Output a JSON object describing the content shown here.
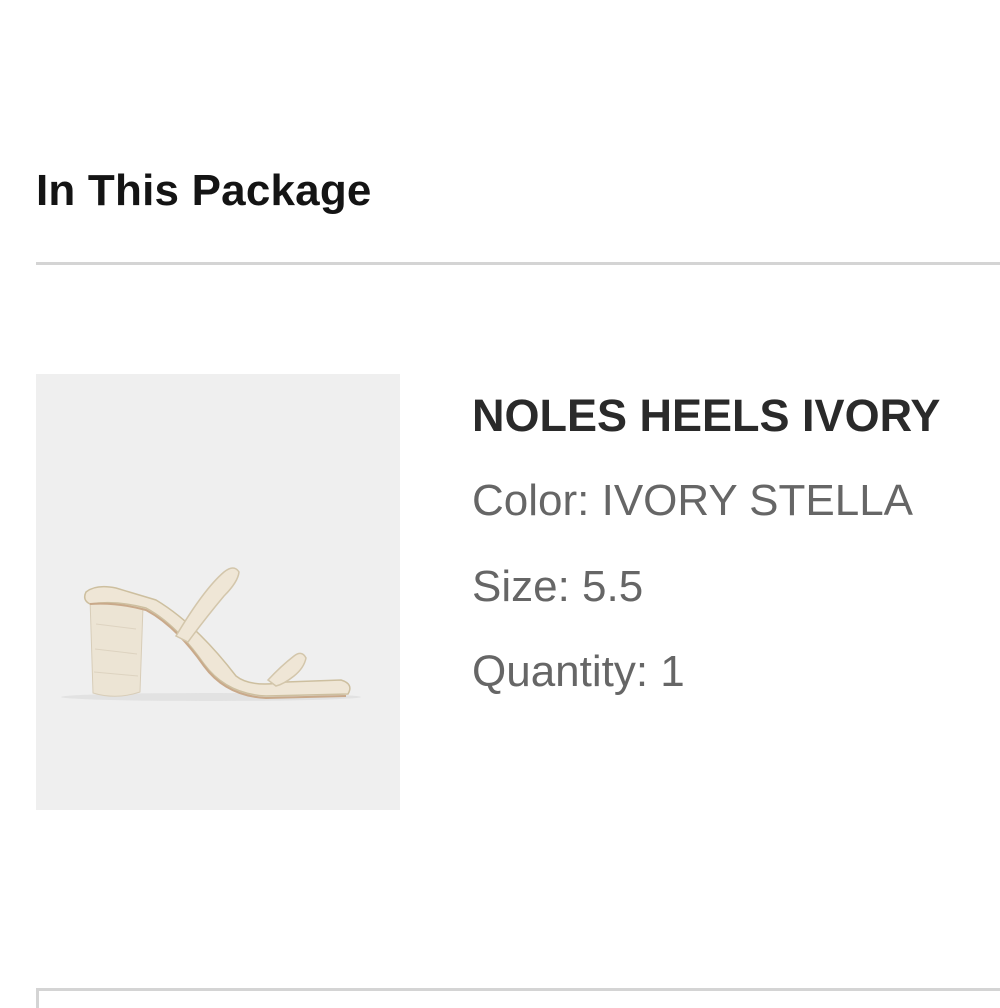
{
  "package": {
    "title": "In This Package"
  },
  "item": {
    "image_alt": "NOLES HEELS IVORY",
    "name": "NOLES HEELS IVORY",
    "color_line": "Color: IVORY STELLA",
    "size_line": "Size: 5.5",
    "quantity_line": "Quantity: 1"
  },
  "colors": {
    "title_text": "#141414",
    "name_text": "#2a2a2a",
    "detail_text": "#666666",
    "divider": "#d4d4d4",
    "image_bg": "#efefef",
    "shoe_cream": "#efe6d6"
  }
}
